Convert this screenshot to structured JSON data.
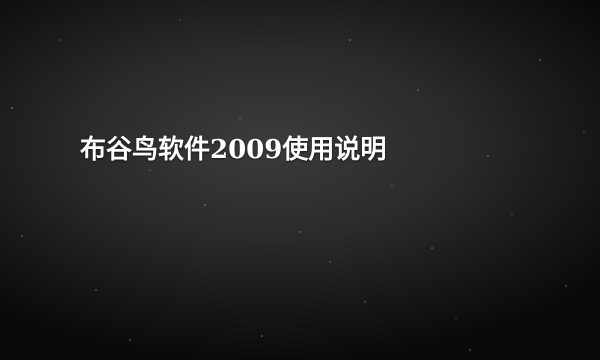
{
  "banner": {
    "title": "布谷鸟软件2009使用说明",
    "background_color": "#2a2a2a",
    "text_color": "#ffffff"
  }
}
